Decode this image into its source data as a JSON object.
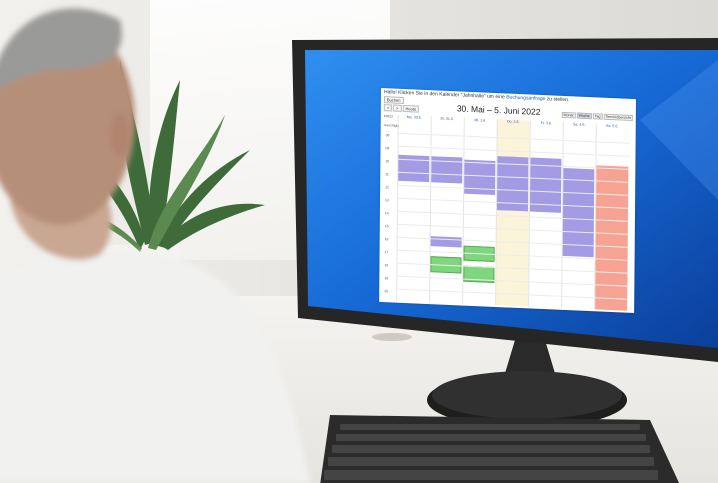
{
  "screen": {
    "hello_prefix": "Hallo! Klicken Sie in den Kalender \"Jahnhalle\" um eine",
    "hello_link": "Buchungsanfrage",
    "hello_suffix": "zu stellen.",
    "buchen_label": "Buchen",
    "nav_prev": "<",
    "nav_next": ">",
    "nav_today": "Heute",
    "title": "30. Mai – 5. Juni 2022",
    "views": [
      "Monat",
      "Woche",
      "Tag",
      "Terminübersicht"
    ],
    "active_view": "Woche",
    "week_label": "KW22",
    "allday_label": "Ganztägig",
    "days": [
      "Mo. 30.5.",
      "Di. 31.5.",
      "Mi. 1.6.",
      "Do. 2.6.",
      "Fr. 3.6.",
      "Sa. 4.6.",
      "So. 5.6."
    ],
    "hours": [
      "08",
      "09",
      "10",
      "11",
      "12",
      "13",
      "14",
      "15",
      "16",
      "17",
      "18",
      "19",
      "20"
    ]
  },
  "colors": {
    "screen_blue": "#1f6fd8",
    "event_purple": "#a39be4",
    "event_green": "#7fd77d",
    "event_salmon": "#f7a394",
    "today_bg": "#fcf4d9"
  }
}
